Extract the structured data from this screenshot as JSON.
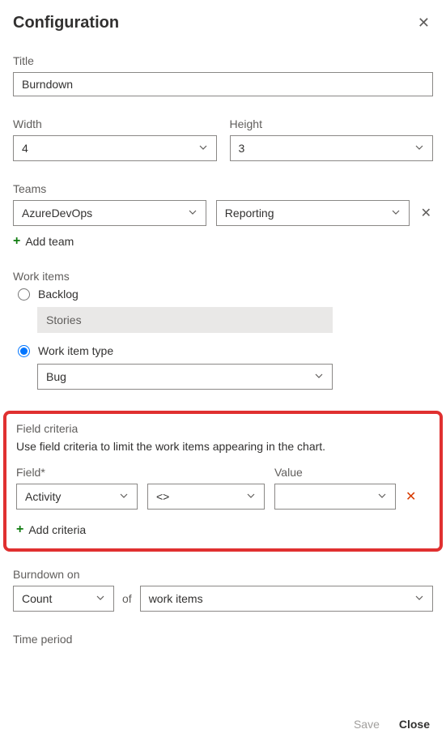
{
  "header": {
    "title": "Configuration"
  },
  "title_field": {
    "label": "Title",
    "value": "Burndown"
  },
  "width_field": {
    "label": "Width",
    "value": "4"
  },
  "height_field": {
    "label": "Height",
    "value": "3"
  },
  "teams": {
    "label": "Teams",
    "values": [
      "AzureDevOps",
      "Reporting"
    ],
    "add_label": "Add team"
  },
  "work_items": {
    "label": "Work items",
    "backlog_label": "Backlog",
    "backlog_value": "Stories",
    "type_label": "Work item type",
    "type_value": "Bug",
    "selected": "type"
  },
  "criteria": {
    "heading": "Field criteria",
    "description": "Use field criteria to limit the work items appearing in the chart.",
    "field_label": "Field*",
    "value_label": "Value",
    "row": {
      "field": "Activity",
      "operator": "<>",
      "value": ""
    },
    "add_label": "Add criteria"
  },
  "burndown": {
    "label": "Burndown on",
    "count": "Count",
    "of": "of",
    "items": "work items"
  },
  "time_period": {
    "label": "Time period"
  },
  "footer": {
    "save": "Save",
    "close": "Close"
  }
}
